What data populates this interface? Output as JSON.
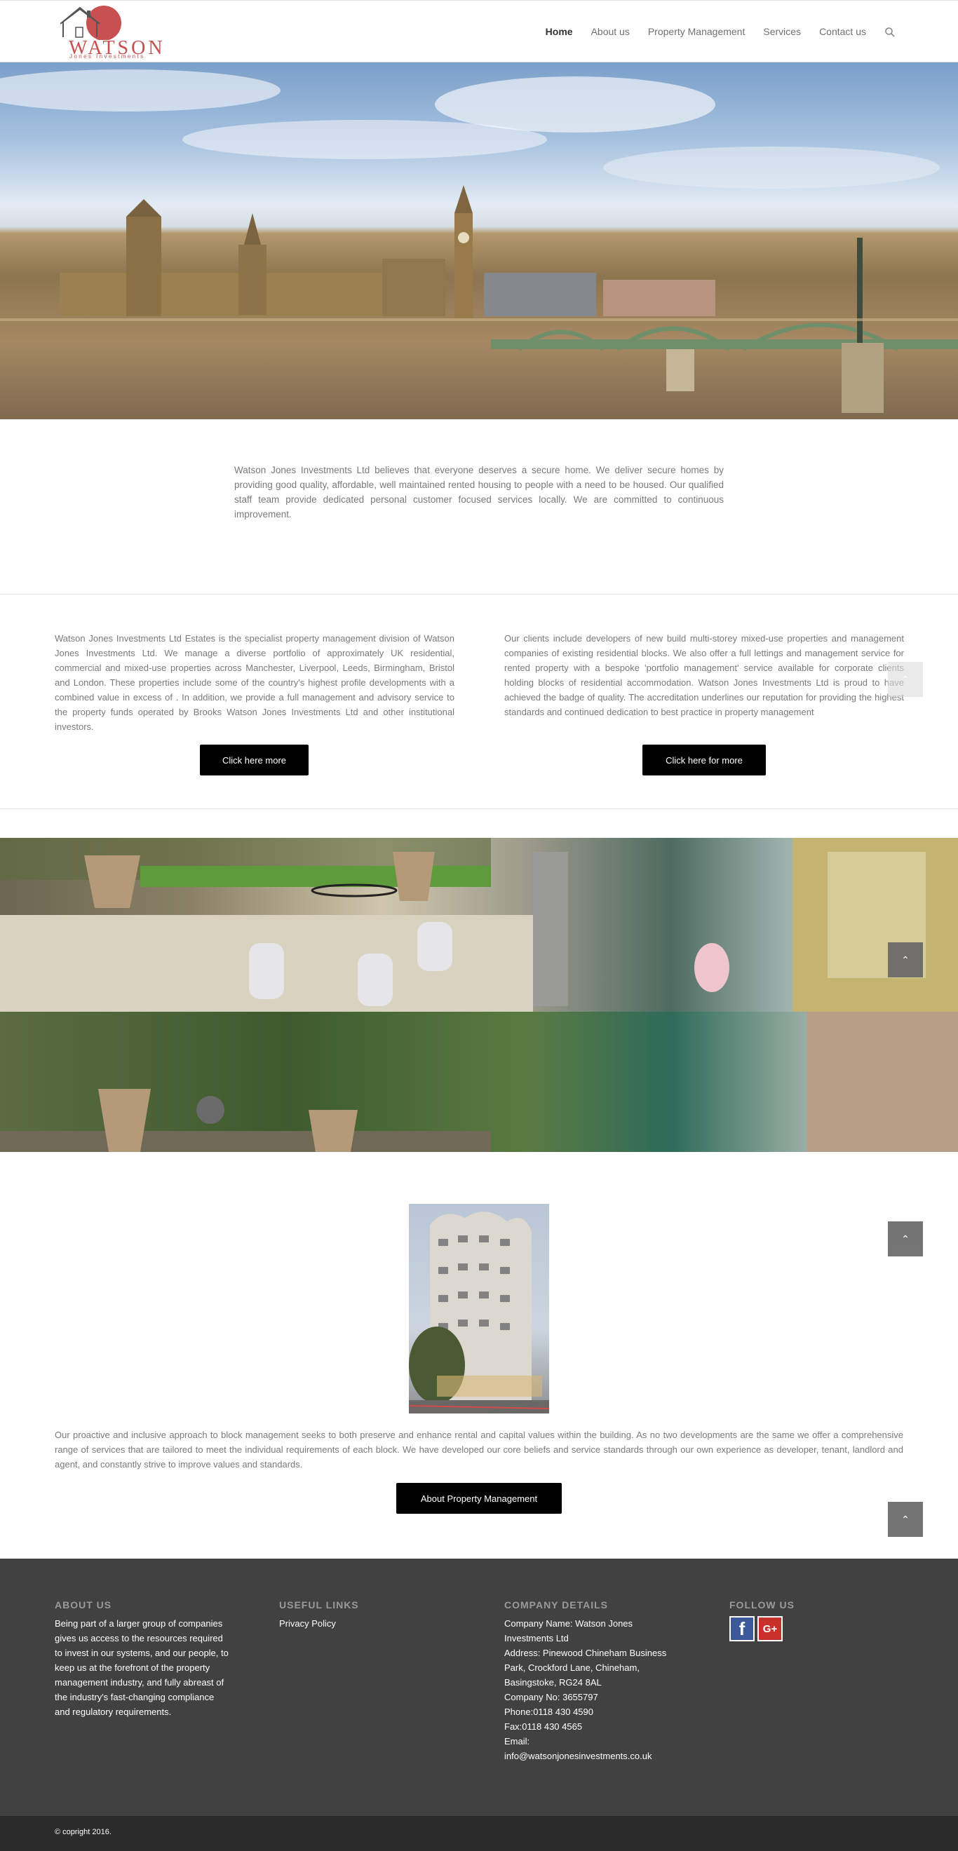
{
  "header": {
    "logo_word": "WATSON",
    "logo_sub": "Jones Investments",
    "nav": [
      "Home",
      "About us",
      "Property Management",
      "Services",
      "Contact us"
    ],
    "active_index": 0
  },
  "intro": {
    "text": "Watson Jones Investments Ltd believes that everyone deserves a secure home. We deliver secure homes by providing good quality, affordable, well maintained rented housing to people with a need to be housed. Our qualified staff team provide dedicated personal customer focused services locally. We are committed to continuous improvement."
  },
  "columns": {
    "left_text": "Watson Jones Investments Ltd Estates is the specialist property management division of Watson Jones Investments Ltd. We manage a diverse portfolio of approximately  UK residential, commercial and mixed-use properties across Manchester, Liverpool, Leeds, Birmingham, Bristol and London. These properties include some of the country's highest profile developments with a combined value in excess of . In addition, we provide a full management and advisory service to the property funds operated by Brooks Watson Jones Investments Ltd and other institutional investors.",
    "left_button": "Click here more",
    "right_text": "Our clients include developers of new build multi-storey mixed-use properties and management companies of existing residential blocks. We also offer a full lettings and management service for rented property with a bespoke 'portfolio management' service available for corporate clients holding blocks of residential accommodation. Watson Jones Investments Ltd is proud to have achieved the  badge of quality. The accreditation underlines our reputation for providing the highest standards and continued dedication to best practice in property management",
    "right_button": "Click here for more"
  },
  "block": {
    "text": "Our proactive and inclusive approach to block management seeks to both preserve and enhance rental and capital values within the building. As no two developments are the same we offer a comprehensive range of services that are tailored to meet the individual requirements of each block. We have developed our core beliefs and service standards through our own experience as developer, tenant, landlord and agent, and constantly strive to improve values and standards.",
    "button": "About Property Management"
  },
  "footer": {
    "about_head": "ABOUT US",
    "about_text": "Being part of a larger group of companies gives us access to the resources required to invest in our systems, and our people, to keep us at the forefront of the property management industry, and fully abreast of the industry's fast-changing compliance and regulatory requirements.",
    "links_head": "USEFUL LINKS",
    "links": [
      "Privacy Policy"
    ],
    "company_head": "COMPANY DETAILS",
    "company_lines": [
      "Company Name: Watson Jones Investments Ltd",
      "Address: Pinewood Chineham Business Park, Crockford Lane, Chineham, Basingstoke, RG24 8AL",
      "Company No: 3655797",
      "Phone:0118 430 4590",
      "Fax:0118 430 4565",
      "Email:",
      "info@watsonjonesinvestments.co.uk"
    ],
    "follow_head": "FOLLOW US",
    "social": [
      {
        "icon": "facebook-icon",
        "glyph": "f",
        "color": "#3b5998"
      },
      {
        "icon": "google-plus-icon",
        "glyph": "G+",
        "color": "#c9302c"
      }
    ]
  },
  "copyright": "© copright 2016.",
  "colors": {
    "accent": "#c85050",
    "footer_bg": "#414141",
    "socket_bg": "#2b2b2b"
  }
}
